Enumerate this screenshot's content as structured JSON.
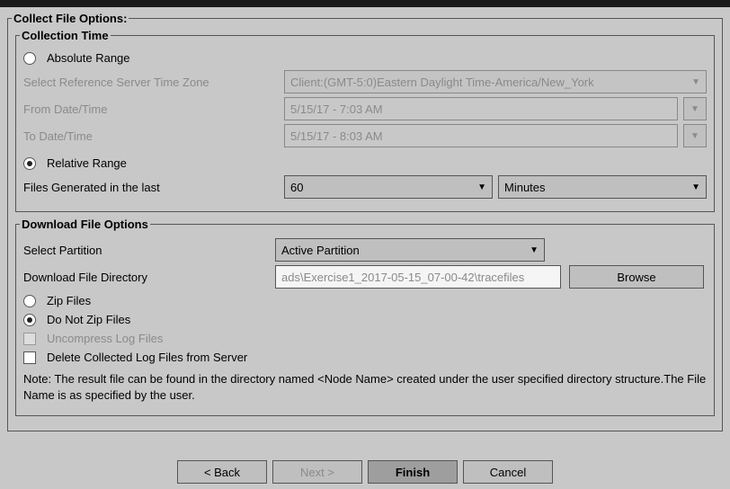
{
  "groups": {
    "collect_options": "Collect File Options:",
    "collection_time": "Collection Time",
    "download_options": "Download File Options"
  },
  "collection": {
    "absolute_range": "Absolute Range",
    "relative_range": "Relative Range",
    "tz_label": "Select Reference Server Time Zone",
    "tz_value": "Client:(GMT-5:0)Eastern Daylight Time-America/New_York",
    "from_label": "From Date/Time",
    "from_value": "5/15/17 - 7:03 AM",
    "to_label": "To Date/Time",
    "to_value": "5/15/17 - 8:03 AM",
    "files_generated_label": "Files Generated in the last",
    "files_generated_value": "60",
    "files_generated_unit": "Minutes"
  },
  "download": {
    "partition_label": "Select Partition",
    "partition_value": "Active Partition",
    "directory_label": "Download File Directory",
    "directory_value": "ads\\Exercise1_2017-05-15_07-00-42\\tracefiles",
    "browse": "Browse",
    "zip_files": "Zip Files",
    "do_not_zip": "Do Not Zip Files",
    "uncompress": "Uncompress Log Files",
    "delete_collected": "Delete Collected Log Files from Server"
  },
  "note": "Note: The result file can be found in the directory named <Node Name> created under\nthe user specified directory structure.The File Name is as specified by the user.",
  "buttons": {
    "back": "< Back",
    "next": "Next >",
    "finish": "Finish",
    "cancel": "Cancel"
  }
}
